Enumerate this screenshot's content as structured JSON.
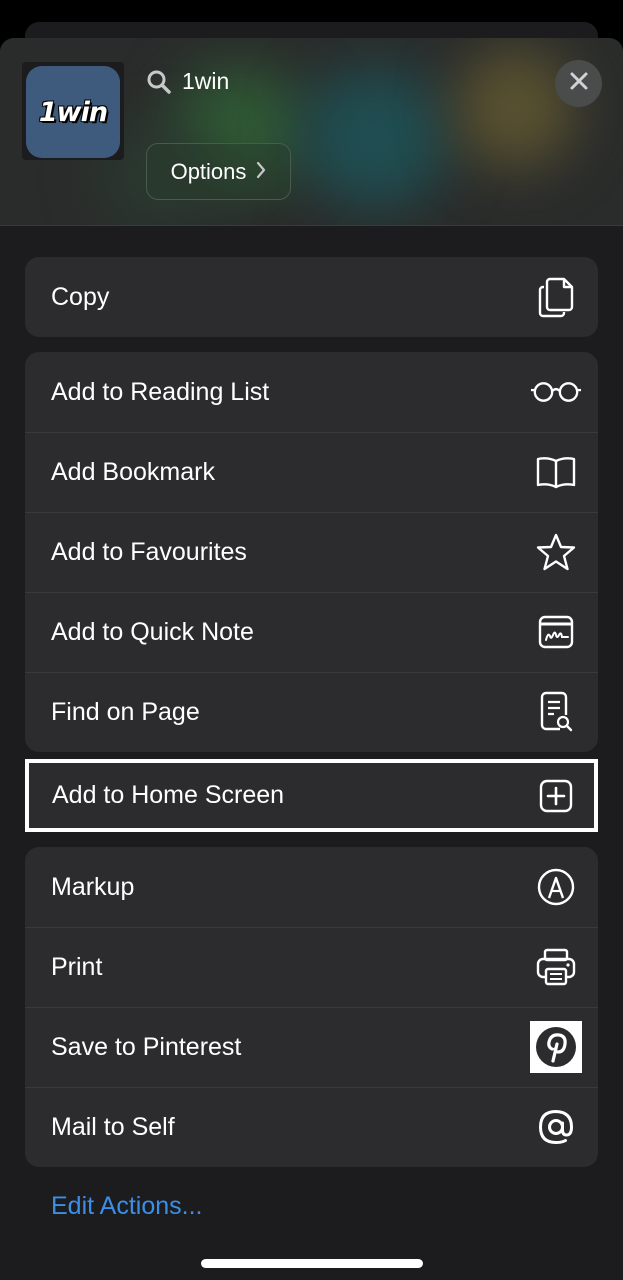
{
  "header": {
    "app_name": "1win",
    "site_title": "1win",
    "options_label": "Options",
    "close_label": "Close"
  },
  "groups": {
    "copy": [
      {
        "label": "Copy",
        "icon": "copy-icon"
      }
    ],
    "reading": [
      {
        "label": "Add to Reading List",
        "icon": "glasses-icon"
      },
      {
        "label": "Add Bookmark",
        "icon": "book-icon"
      },
      {
        "label": "Add to Favourites",
        "icon": "star-icon"
      },
      {
        "label": "Add to Quick Note",
        "icon": "quick-note-icon"
      },
      {
        "label": "Find on Page",
        "icon": "find-on-page-icon"
      }
    ],
    "highlighted": {
      "label": "Add to Home Screen",
      "icon": "add-square-icon"
    },
    "actions": [
      {
        "label": "Markup",
        "icon": "markup-icon"
      },
      {
        "label": "Print",
        "icon": "printer-icon"
      },
      {
        "label": "Save to Pinterest",
        "icon": "pinterest-icon"
      },
      {
        "label": "Mail to Self",
        "icon": "at-sign-icon"
      }
    ]
  },
  "footer": {
    "edit_actions_label": "Edit Actions..."
  },
  "colors": {
    "sheet_background": "#1c1c1e",
    "row_background": "#2c2c2e",
    "link_blue": "#3a8fe8",
    "app_icon_background": "#3e5b7e"
  }
}
